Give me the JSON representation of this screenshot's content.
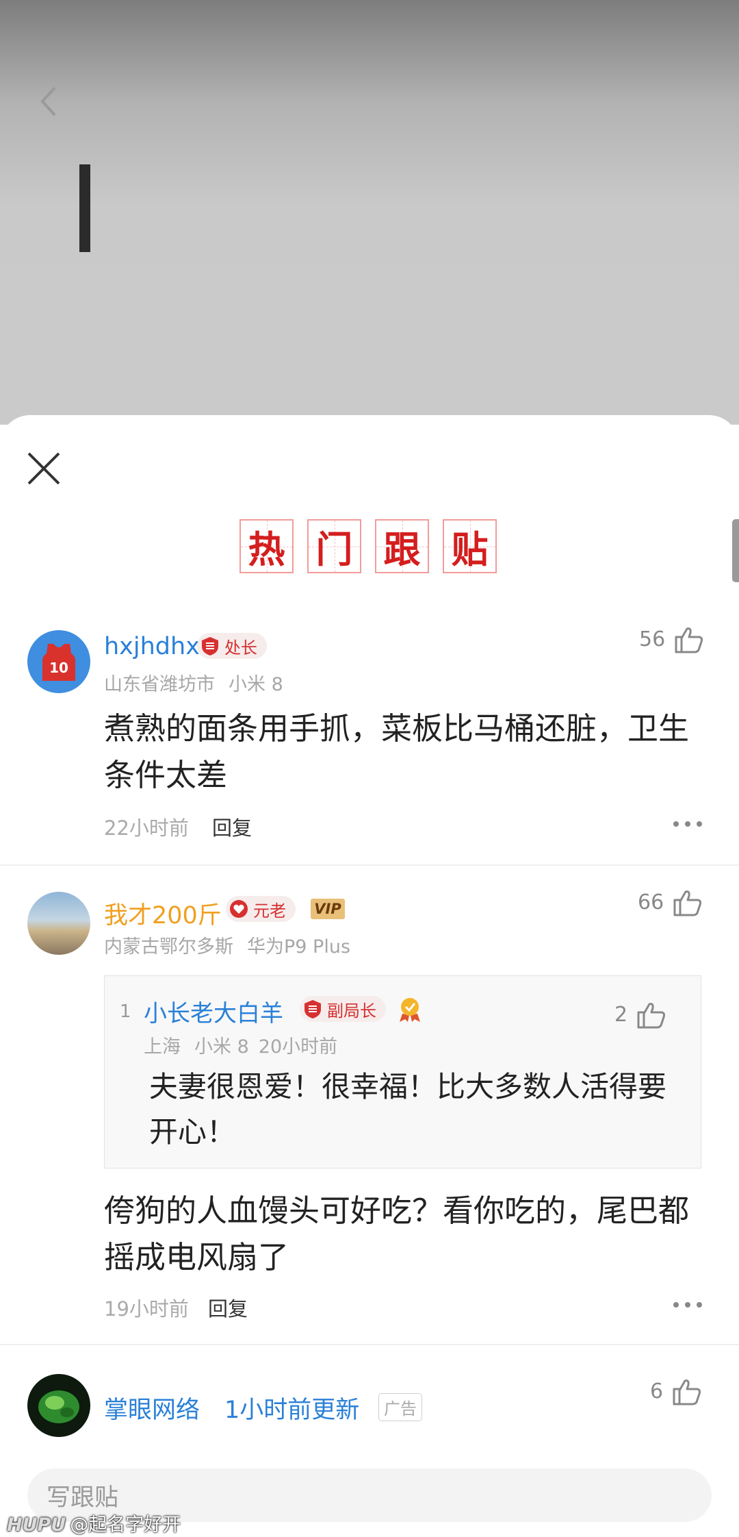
{
  "hot_title": [
    "热",
    "门",
    "跟",
    "贴"
  ],
  "comments": [
    {
      "username": "hxjhdhx",
      "rank": "处长",
      "location": "山东省潍坊市",
      "device": "小米 8",
      "likes": "56",
      "text": "煮熟的面条用手抓，菜板比马桶还脏，卫生条件太差",
      "time": "22小时前",
      "reply_label": "回复"
    },
    {
      "username": "我才200斤",
      "rank": "元老",
      "vip": "VIP",
      "location": "内蒙古鄂尔多斯",
      "device": "华为P9 Plus",
      "likes": "66",
      "quote": {
        "index": "1",
        "username": "小长老大白羊",
        "rank": "副局长",
        "location": "上海",
        "device": "小米 8",
        "time": "20小时前",
        "likes": "2",
        "text": "夫妻很恩爱！很幸福！比大多数人活得要开心！"
      },
      "text": "侉狗的人血馒头可好吃？看你吃的，尾巴都摇成电风扇了",
      "time": "19小时前",
      "reply_label": "回复"
    }
  ],
  "ad": {
    "name": "掌眼网络",
    "update": "1小时前更新",
    "label": "广告",
    "likes": "6"
  },
  "write_placeholder": "写跟贴",
  "watermark": {
    "logo": "HUPU",
    "text": "@起名字好开"
  },
  "colors": {
    "username_blue": "#2a80d8",
    "username_gold": "#f0a020",
    "hot_red": "#d41e1e"
  }
}
